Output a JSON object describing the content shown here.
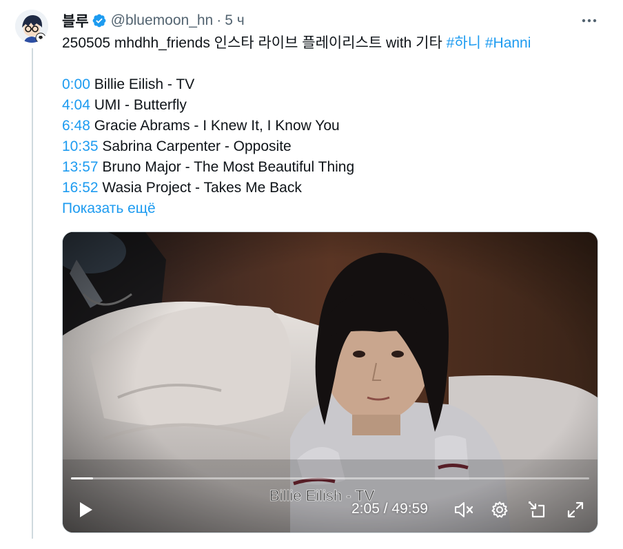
{
  "tweet": {
    "display_name": "블루",
    "handle": "@bluemoon_hn",
    "separator": "·",
    "time_ago": "5 ч",
    "more_icon": "more-icon",
    "text_prefix": "250505 mhdhh_friends 인스타 라이브 플레이리스트 with 기타",
    "hashtags": [
      "#하니",
      "#Hanni"
    ],
    "tracks": [
      {
        "time": "0:00",
        "title": "Billie Eilish - TV"
      },
      {
        "time": "4:04",
        "title": "UMI - Butterfly"
      },
      {
        "time": "6:48",
        "title": "Gracie Abrams - I Knew It, I Know You"
      },
      {
        "time": "10:35",
        "title": "Sabrina Carpenter - Opposite"
      },
      {
        "time": "13:57",
        "title": "Bruno Major - The Most Beautiful Thing"
      },
      {
        "time": "16:52",
        "title": "Wasia Project - Takes Me Back"
      }
    ],
    "show_more": "Показать ещё"
  },
  "video": {
    "caption": "Billie Eilish - TV",
    "current_time": "2:05",
    "time_separator": " / ",
    "duration": "49:59",
    "progress_fraction": 0.042,
    "icons": [
      "play-icon",
      "mute-icon",
      "settings-icon",
      "pop-out-icon",
      "fullscreen-icon"
    ]
  },
  "colors": {
    "accent": "#1d9bf0",
    "text": "#0f1419",
    "secondary": "#536471",
    "thread_line": "#cfd9de"
  }
}
